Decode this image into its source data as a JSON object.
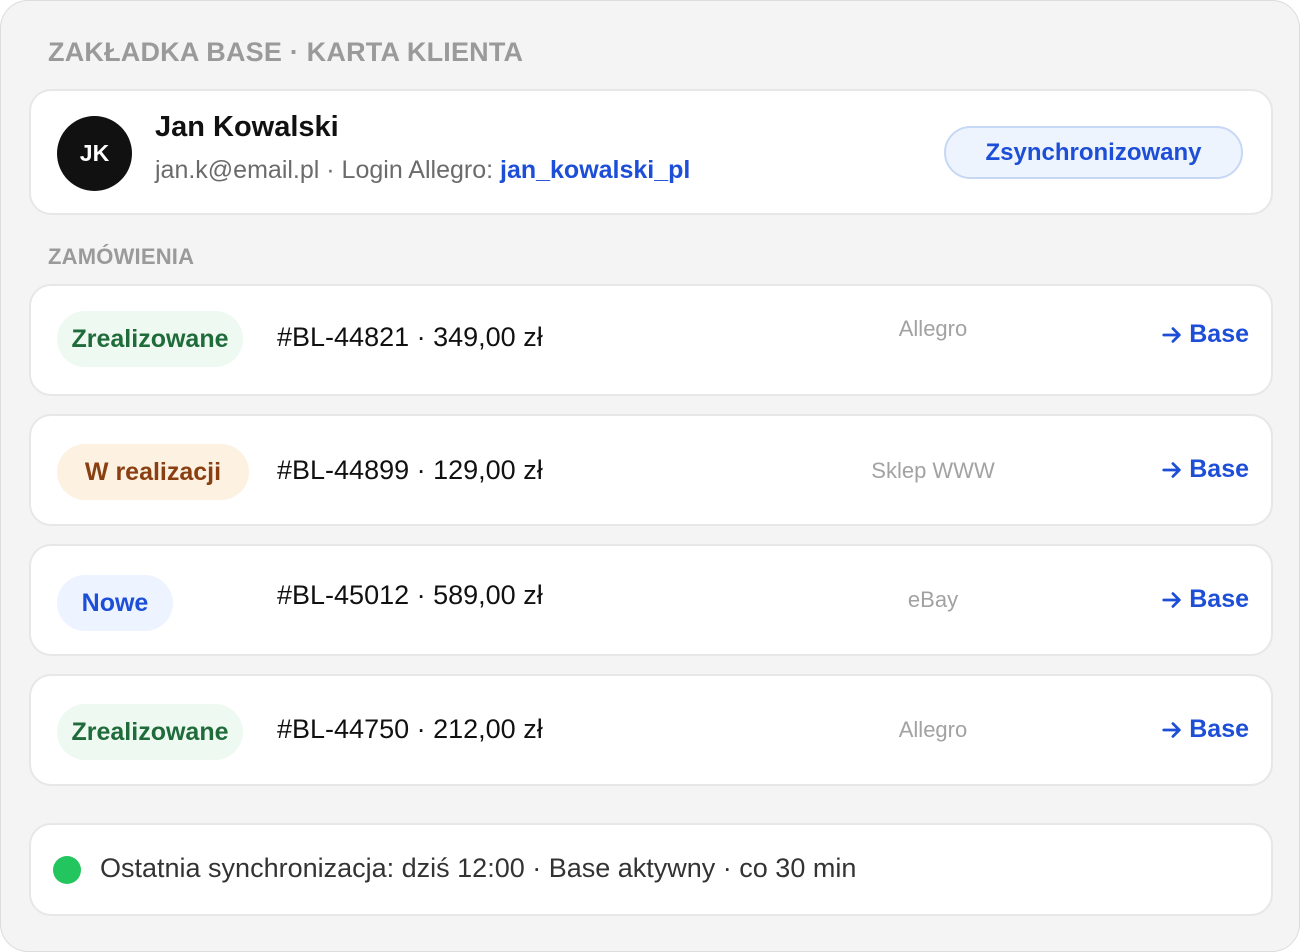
{
  "header": {
    "title": "ZAKŁADKA BASE · KARTA KLIENTA"
  },
  "client": {
    "initials": "JK",
    "name": "Jan Kowalski",
    "email_prefix": "jan.k@email.pl · Login Allegro: ",
    "allegro_login": "jan_kowalski_pl",
    "sync_status": "Zsynchronizowany"
  },
  "orders_section": {
    "title": "ZAMÓWIENIA"
  },
  "orders": [
    {
      "status": "Zrealizowane",
      "id_amount": "#BL-44821 · 349,00 zł",
      "channel": "Allegro",
      "link": "Base"
    },
    {
      "status": "W realizacji",
      "id_amount": "#BL-44899 · 129,00 zł",
      "channel": "Sklep WWW",
      "link": "Base"
    },
    {
      "status": "Nowe",
      "id_amount": "#BL-45012 · 589,00 zł",
      "channel": "eBay",
      "link": "Base"
    },
    {
      "status": "Zrealizowane",
      "id_amount": "#BL-44750 · 212,00 zł",
      "channel": "Allegro",
      "link": "Base"
    }
  ],
  "footer": {
    "sync_text": "Ostatnia synchronizacja: dziś 12:00 · Base aktywny · co 30 min"
  },
  "colors": {
    "accent": "#1d4ed8",
    "done": "#1f6b3a",
    "in_progress": "#8a3f12",
    "active_dot": "#22c55e"
  }
}
